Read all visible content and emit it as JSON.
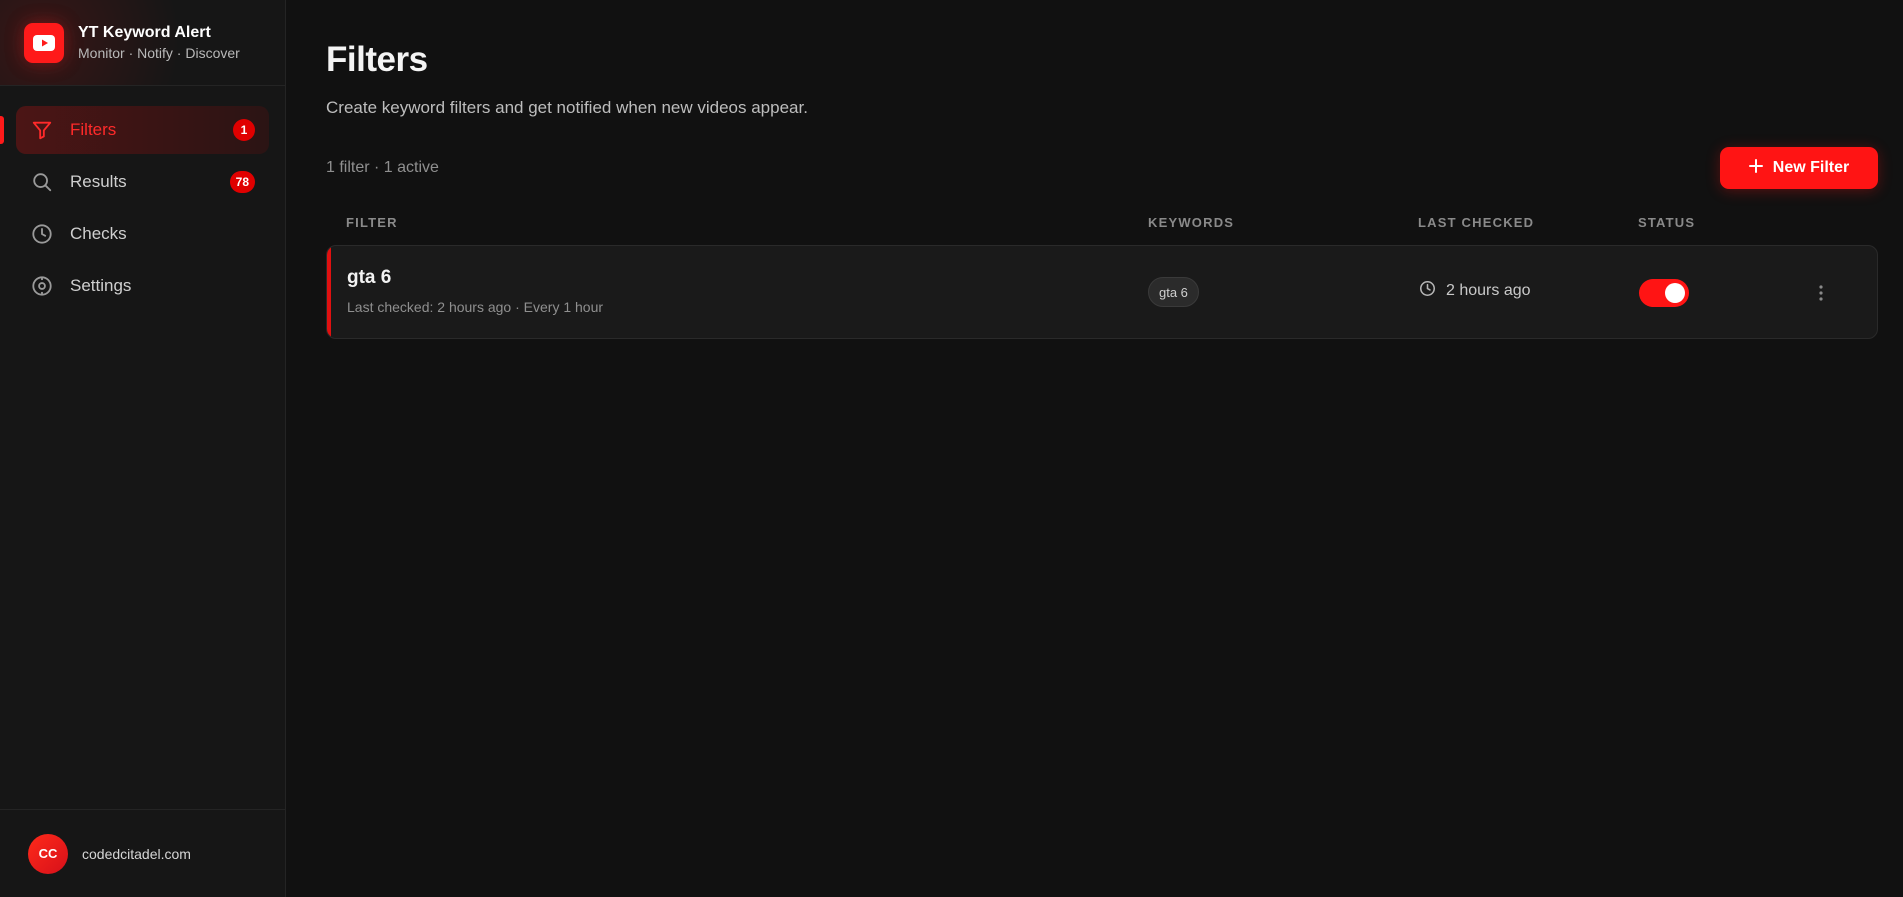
{
  "brand": {
    "title": "YT Keyword Alert",
    "subtitle": "Monitor · Notify · Discover",
    "logo_icon": "youtube-play-icon",
    "accent_color": "#ff1a1a"
  },
  "sidebar": {
    "items": [
      {
        "label": "Filters",
        "icon": "filter-icon",
        "badge": "1",
        "active": true
      },
      {
        "label": "Results",
        "icon": "search-icon",
        "badge": "78",
        "active": false
      },
      {
        "label": "Checks",
        "icon": "clock-icon",
        "badge": null,
        "active": false
      },
      {
        "label": "Settings",
        "icon": "gear-icon",
        "badge": null,
        "active": false
      }
    ]
  },
  "user": {
    "initials": "CC",
    "name": "codedcitadel.com"
  },
  "page": {
    "title": "Filters",
    "description": "Create keyword filters and get notified when new videos appear.",
    "summary": "1 filter · 1 active",
    "new_button": "New Filter"
  },
  "table": {
    "columns": [
      "FILTER",
      "KEYWORDS",
      "LAST CHECKED",
      "STATUS"
    ],
    "rows": [
      {
        "name": "gta 6",
        "meta": "Last checked: 2 hours ago · Every 1 hour",
        "keywords": [
          "gta 6"
        ],
        "last_checked": "2 hours ago",
        "status_active": true
      }
    ]
  }
}
